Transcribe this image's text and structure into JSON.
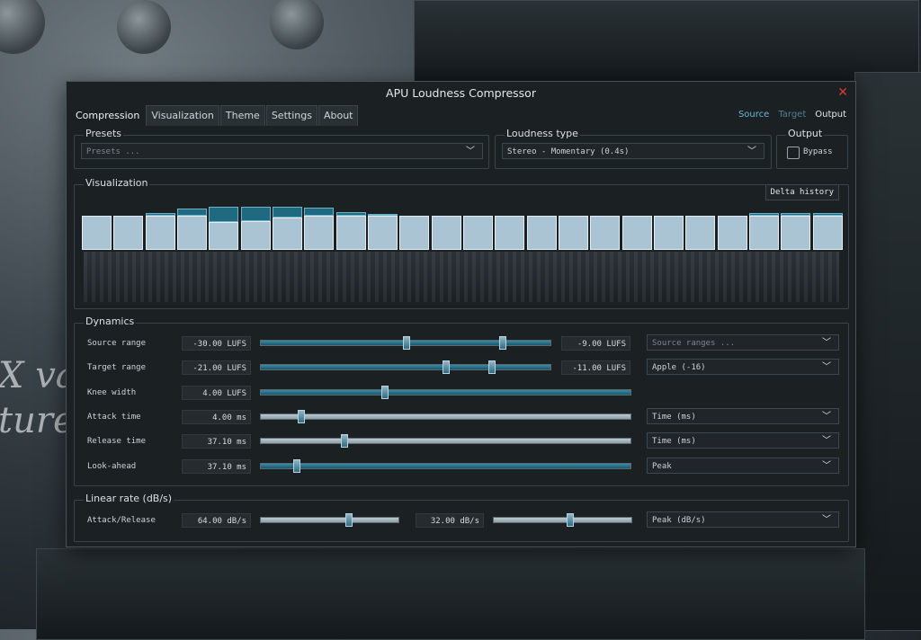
{
  "window": {
    "title": "APU Loudness Compressor"
  },
  "tabs": [
    {
      "label": "Compression",
      "active": true
    },
    {
      "label": "Visualization",
      "active": false
    },
    {
      "label": "Theme",
      "active": false
    },
    {
      "label": "Settings",
      "active": false
    },
    {
      "label": "About",
      "active": false
    }
  ],
  "view_links": [
    {
      "label": "Source",
      "color": "#6fb4d6"
    },
    {
      "label": "Target",
      "color": "#4f7f90"
    },
    {
      "label": "Output",
      "color": "#e4e8ea"
    }
  ],
  "presets": {
    "title": "Presets",
    "placeholder": "Presets ..."
  },
  "loudness_type": {
    "title": "Loudness type",
    "value": "Stereo - Momentary (0.4s)"
  },
  "output": {
    "title": "Output",
    "bypass_label": "Bypass",
    "bypass_checked": false
  },
  "visualization": {
    "title": "Visualization",
    "delta_history_label": "Delta history",
    "bars": [
      {
        "level": 0.4,
        "delta": 0.0
      },
      {
        "level": 0.4,
        "delta": 0.0
      },
      {
        "level": 0.4,
        "delta": 0.06
      },
      {
        "level": 0.4,
        "delta": 0.16
      },
      {
        "level": 0.4,
        "delta": 0.36
      },
      {
        "level": 0.4,
        "delta": 0.34
      },
      {
        "level": 0.4,
        "delta": 0.26
      },
      {
        "level": 0.4,
        "delta": 0.18
      },
      {
        "level": 0.4,
        "delta": 0.08
      },
      {
        "level": 0.4,
        "delta": 0.05
      },
      {
        "level": 0.4,
        "delta": 0.0
      },
      {
        "level": 0.4,
        "delta": 0.0
      },
      {
        "level": 0.4,
        "delta": 0.0
      },
      {
        "level": 0.4,
        "delta": 0.0
      },
      {
        "level": 0.4,
        "delta": 0.0
      },
      {
        "level": 0.4,
        "delta": 0.0
      },
      {
        "level": 0.4,
        "delta": 0.0
      },
      {
        "level": 0.4,
        "delta": 0.0
      },
      {
        "level": 0.4,
        "delta": 0.0
      },
      {
        "level": 0.4,
        "delta": 0.0
      },
      {
        "level": 0.4,
        "delta": 0.0
      },
      {
        "level": 0.4,
        "delta": 0.06
      },
      {
        "level": 0.4,
        "delta": 0.06
      },
      {
        "level": 0.4,
        "delta": 0.06
      }
    ]
  },
  "dynamics": {
    "title": "Dynamics",
    "rows": [
      {
        "label": "Source range",
        "value": "-30.00 LUFS",
        "value2": "-9.00 LUFS",
        "combo": "Source ranges ...",
        "combo_placeholder": true,
        "handles": [
          0.5,
          0.84
        ]
      },
      {
        "label": "Target range",
        "value": "-21.00 LUFS",
        "value2": "-11.00 LUFS",
        "combo": "Apple (-16)",
        "combo_placeholder": false,
        "handles": [
          0.64,
          0.8
        ]
      },
      {
        "label": "Knee width",
        "value": "4.00 LUFS",
        "value2": "",
        "combo": "",
        "combo_placeholder": false,
        "handles": [
          0.33
        ]
      },
      {
        "label": "Attack time",
        "value": "4.00 ms",
        "value2": "",
        "combo": "Time (ms)",
        "combo_placeholder": false,
        "handles": [
          0.1
        ]
      },
      {
        "label": "Release time",
        "value": "37.10 ms",
        "value2": "",
        "combo": "Time (ms)",
        "combo_placeholder": false,
        "handles": [
          0.22
        ]
      },
      {
        "label": "Look-ahead",
        "value": "37.10 ms",
        "value2": "",
        "combo": "Peak",
        "combo_placeholder": false,
        "handles": [
          0.09
        ]
      }
    ]
  },
  "linear_rate": {
    "title": "Linear rate (dB/s)",
    "label": "Attack/Release",
    "value": "64.00 dB/s",
    "value2": "32.00 dB/s",
    "combo": "Peak (dB/s)",
    "handle1": 0.64,
    "handle2": 0.55
  },
  "colors": {
    "accent": "#1f6a80",
    "window_bg": "#1b2023",
    "close": "#d83a3a"
  }
}
